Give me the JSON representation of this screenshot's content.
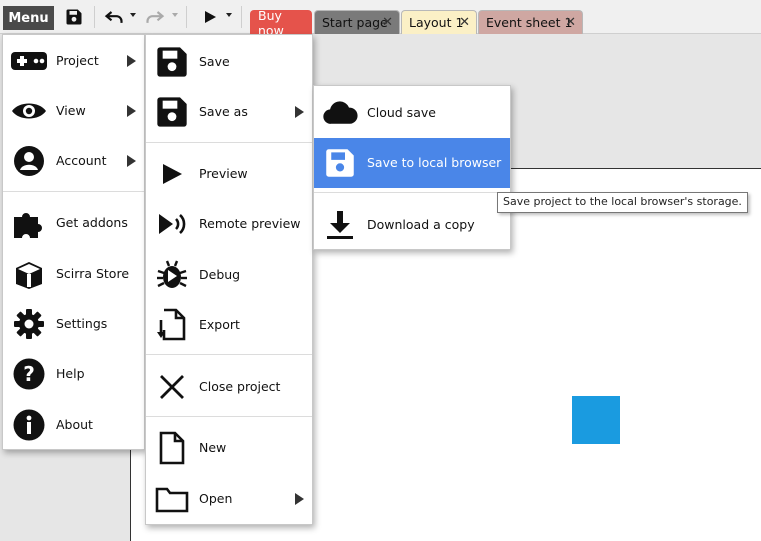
{
  "toolbar": {
    "menu_label": "Menu",
    "save_icon": "save-icon",
    "undo_icon": "undo-icon",
    "redo_icon": "redo-icon",
    "play_icon": "play-icon"
  },
  "tabs": [
    {
      "label": "Buy now",
      "closable": false,
      "bg": "#e5534b",
      "color": "#ffffff"
    },
    {
      "label": "Start page",
      "closable": true,
      "bg": "#7a7a7a",
      "color": "#111111"
    },
    {
      "label": "Layout 1",
      "closable": true,
      "bg": "#fbf0c6",
      "color": "#111111",
      "active": true
    },
    {
      "label": "Event sheet 1",
      "closable": true,
      "bg": "#cfa7a2",
      "color": "#111111"
    }
  ],
  "main_menu": {
    "items": [
      {
        "label": "Project",
        "icon": "gamepad-icon",
        "submenu": true
      },
      {
        "label": "View",
        "icon": "eye-icon",
        "submenu": true
      },
      {
        "label": "Account",
        "icon": "account-icon",
        "submenu": true
      },
      {
        "label": "Get addons",
        "icon": "puzzle-icon",
        "submenu": false
      },
      {
        "label": "Scirra Store",
        "icon": "store-icon",
        "submenu": false
      },
      {
        "label": "Settings",
        "icon": "gear-icon",
        "submenu": false
      },
      {
        "label": "Help",
        "icon": "help-icon",
        "submenu": false
      },
      {
        "label": "About",
        "icon": "info-icon",
        "submenu": false
      }
    ]
  },
  "project_menu": {
    "items": [
      {
        "label": "Save",
        "icon": "save-icon",
        "submenu": false
      },
      {
        "label": "Save as",
        "icon": "save-as-icon",
        "submenu": true
      },
      {
        "label": "Preview",
        "icon": "play-icon",
        "submenu": false
      },
      {
        "label": "Remote preview",
        "icon": "remote-preview-icon",
        "submenu": false
      },
      {
        "label": "Debug",
        "icon": "bug-icon",
        "submenu": false
      },
      {
        "label": "Export",
        "icon": "export-icon",
        "submenu": false
      },
      {
        "label": "Close project",
        "icon": "close-icon",
        "submenu": false
      },
      {
        "label": "New",
        "icon": "new-file-icon",
        "submenu": false
      },
      {
        "label": "Open",
        "icon": "folder-icon",
        "submenu": true
      }
    ]
  },
  "save_as_menu": {
    "items": [
      {
        "label": "Cloud save",
        "icon": "cloud-icon",
        "highlighted": false
      },
      {
        "label": "Save to local browser",
        "icon": "browser-save-icon",
        "highlighted": true
      },
      {
        "label": "Download a copy",
        "icon": "download-icon",
        "highlighted": false
      }
    ]
  },
  "tooltip": {
    "text": "Save project to the local browser's storage."
  },
  "colors": {
    "highlight": "#4a86e8",
    "sprite": "#1a9be0",
    "menu_button": "#4a4a4a"
  }
}
